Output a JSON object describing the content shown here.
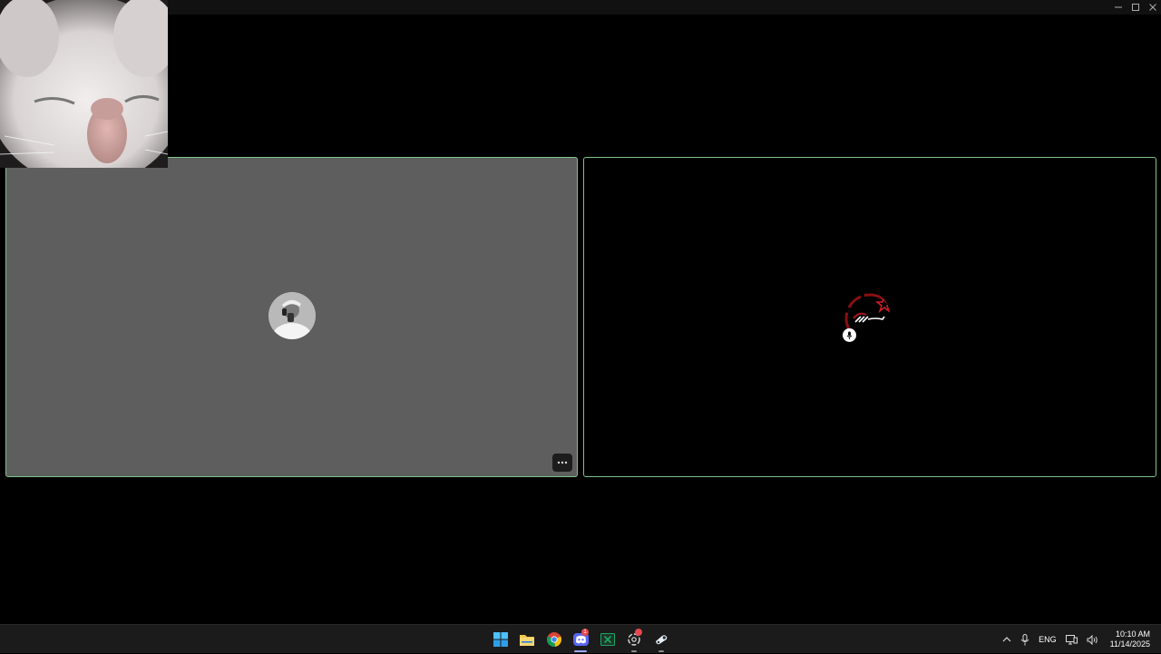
{
  "window": {
    "controls": [
      "minimize-icon",
      "maximize-icon",
      "close-icon"
    ]
  },
  "self_view": {
    "icon": "cat-video-feed"
  },
  "participants": [
    {
      "id": "left",
      "background": "#5e5e5e",
      "border": "#7bc48a",
      "avatar": "person-avatar-grayscale",
      "more_label": "···"
    },
    {
      "id": "right",
      "background": "#000000",
      "border": "#7bc48a",
      "avatar": "red-circle-logo-avatar",
      "muted": true
    }
  ],
  "taskbar": {
    "apps": [
      {
        "name": "start",
        "icon": "windows-logo-icon"
      },
      {
        "name": "file-explorer",
        "icon": "folder-icon"
      },
      {
        "name": "chrome",
        "icon": "chrome-icon"
      },
      {
        "name": "discord",
        "icon": "discord-icon",
        "badge": "1",
        "active": true
      },
      {
        "name": "excel",
        "icon": "excel-icon"
      },
      {
        "name": "chatgpt",
        "icon": "openai-icon",
        "dot": true
      },
      {
        "name": "steam",
        "icon": "steam-icon"
      }
    ],
    "tray": {
      "language": "ENG",
      "time": "10:10 AM",
      "date": "11/14/2025"
    }
  }
}
